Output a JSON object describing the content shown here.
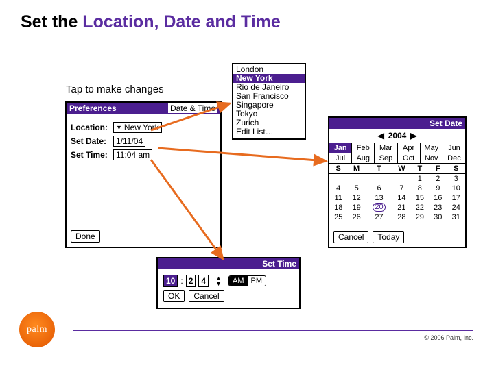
{
  "title_pre": "Set the ",
  "title_accent": "Location, Date and Time",
  "caption": "Tap to make changes",
  "prefs": {
    "panel_title": "Preferences",
    "panel_sub": "Date & Time",
    "loc_label": "Location:",
    "loc_value": "New York",
    "date_label": "Set Date:",
    "date_value": "1/11/04",
    "time_label": "Set Time:",
    "time_value": "11:04 am",
    "done": "Done"
  },
  "cities": [
    "London",
    "New York",
    "Rio de Janeiro",
    "San Francisco",
    "Singapore",
    "Tokyo",
    "Zurich",
    "Edit List…"
  ],
  "setdate": {
    "title": "Set Date",
    "year": "2004",
    "months": [
      "Jan",
      "Feb",
      "Mar",
      "Apr",
      "May",
      "Jun",
      "Jul",
      "Aug",
      "Sep",
      "Oct",
      "Nov",
      "Dec"
    ],
    "dow": [
      "S",
      "M",
      "T",
      "W",
      "T",
      "F",
      "S"
    ],
    "grid": [
      [
        "",
        "",
        "",
        "",
        "1",
        "2",
        "3"
      ],
      [
        "4",
        "5",
        "6",
        "7",
        "8",
        "9",
        "10"
      ],
      [
        "11",
        "12",
        "13",
        "14",
        "15",
        "16",
        "17"
      ],
      [
        "18",
        "19",
        "20",
        "21",
        "22",
        "23",
        "24"
      ],
      [
        "25",
        "26",
        "27",
        "28",
        "29",
        "30",
        "31"
      ]
    ],
    "today_cell": "20",
    "cancel": "Cancel",
    "today": "Today"
  },
  "settime": {
    "title": "Set Time",
    "hour": "10",
    "m1": "2",
    "m2": "4",
    "am": "AM",
    "pm": "PM",
    "ok": "OK",
    "cancel": "Cancel"
  },
  "copyright": "© 2006 Palm, Inc.",
  "logo_text": "palm"
}
